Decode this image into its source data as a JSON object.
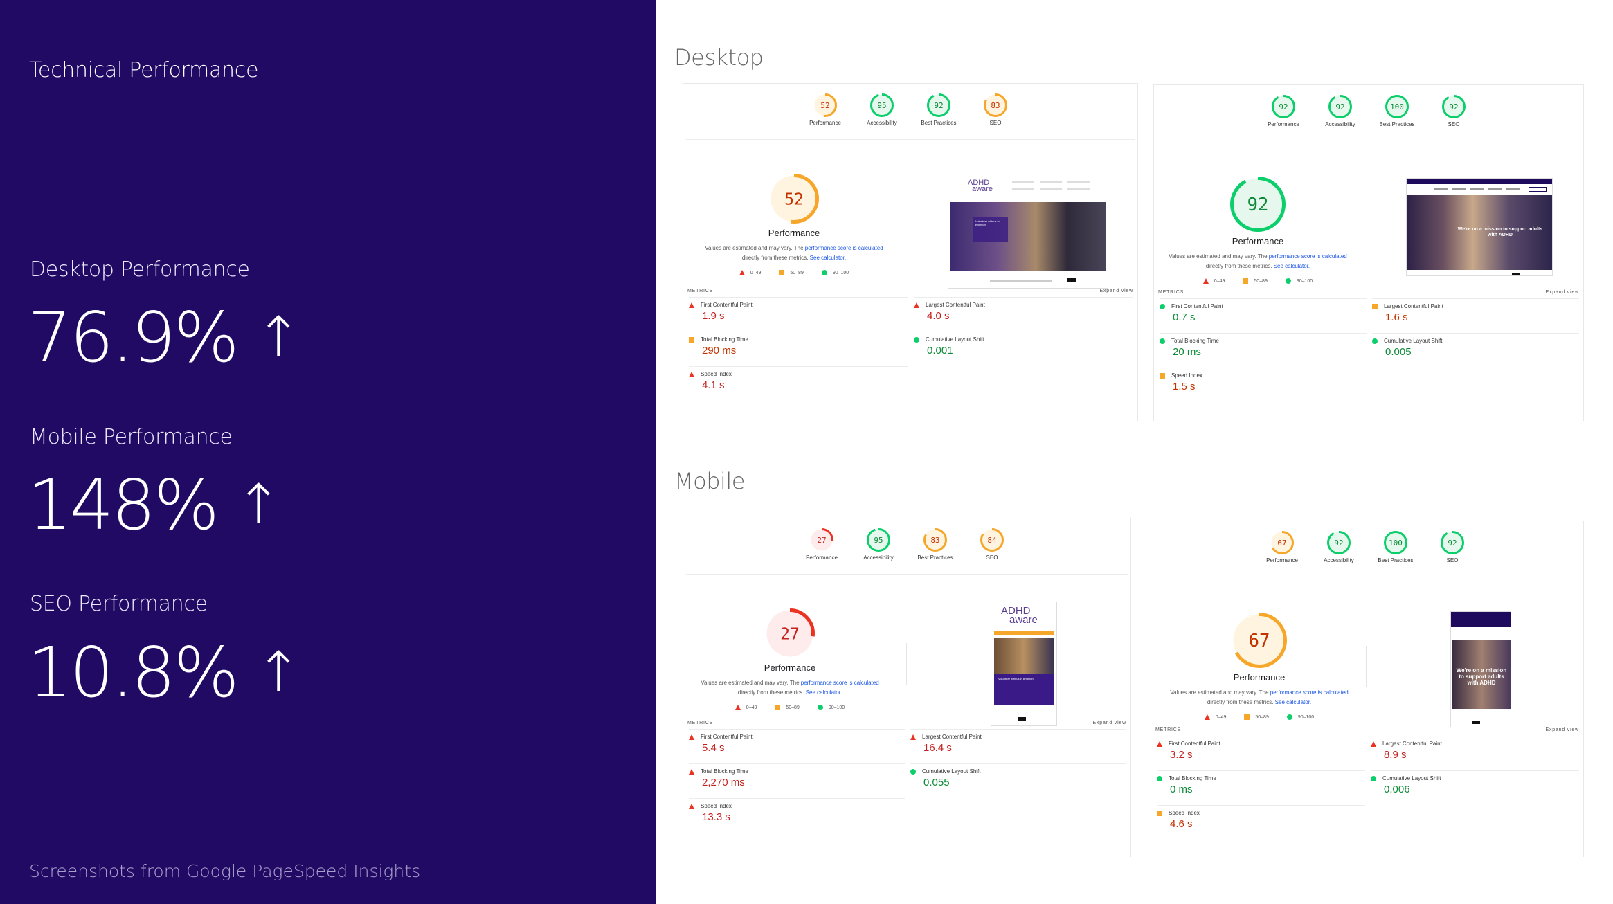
{
  "panel": {
    "title": "Technical Performance",
    "stats": [
      {
        "label": "Desktop Performance",
        "value": "76.9%",
        "arrow": "↑"
      },
      {
        "label": "Mobile Performance",
        "value": "148%",
        "arrow": "↑"
      },
      {
        "label": "SEO Performance",
        "value": "10.8%",
        "arrow": "↑"
      }
    ],
    "footnote": "Screenshots from Google PageSpeed Insights"
  },
  "sections": {
    "desktop": "Desktop",
    "mobile": "Mobile"
  },
  "common": {
    "performance": "Performance",
    "note_a": "Values are estimated and may vary. The ",
    "note_link": "performance score is calculated",
    "note_b": " directly from these metrics. ",
    "note_calc": "See calculator.",
    "legend": [
      "0–49",
      "50–89",
      "90–100"
    ],
    "metrics_label": "METRICS",
    "expand": "Expand view"
  },
  "reports": [
    {
      "gauges": [
        {
          "label": "Performance",
          "score": 52
        },
        {
          "label": "Accessibility",
          "score": 95
        },
        {
          "label": "Best Practices",
          "score": 92
        },
        {
          "label": "SEO",
          "score": 83
        }
      ],
      "big_score": 52,
      "metrics": [
        {
          "name": "First Contentful Paint",
          "value": "1.9 s",
          "status": "poor"
        },
        {
          "name": "Largest Contentful Paint",
          "value": "4.0 s",
          "status": "poor"
        },
        {
          "name": "Total Blocking Time",
          "value": "290 ms",
          "status": "average"
        },
        {
          "name": "Cumulative Layout Shift",
          "value": "0.001",
          "status": "good"
        },
        {
          "name": "Speed Index",
          "value": "4.1 s",
          "status": "poor"
        }
      ]
    },
    {
      "gauges": [
        {
          "label": "Performance",
          "score": 92
        },
        {
          "label": "Accessibility",
          "score": 92
        },
        {
          "label": "Best Practices",
          "score": 100
        },
        {
          "label": "SEO",
          "score": 92
        }
      ],
      "big_score": 92,
      "metrics": [
        {
          "name": "First Contentful Paint",
          "value": "0.7 s",
          "status": "good"
        },
        {
          "name": "Largest Contentful Paint",
          "value": "1.6 s",
          "status": "average"
        },
        {
          "name": "Total Blocking Time",
          "value": "20 ms",
          "status": "good"
        },
        {
          "name": "Cumulative Layout Shift",
          "value": "0.005",
          "status": "good"
        },
        {
          "name": "Speed Index",
          "value": "1.5 s",
          "status": "average"
        }
      ]
    },
    {
      "gauges": [
        {
          "label": "Performance",
          "score": 27
        },
        {
          "label": "Accessibility",
          "score": 95
        },
        {
          "label": "Best Practices",
          "score": 83
        },
        {
          "label": "SEO",
          "score": 84
        }
      ],
      "big_score": 27,
      "metrics": [
        {
          "name": "First Contentful Paint",
          "value": "5.4 s",
          "status": "poor"
        },
        {
          "name": "Largest Contentful Paint",
          "value": "16.4 s",
          "status": "poor"
        },
        {
          "name": "Total Blocking Time",
          "value": "2,270 ms",
          "status": "poor"
        },
        {
          "name": "Cumulative Layout Shift",
          "value": "0.055",
          "status": "good"
        },
        {
          "name": "Speed Index",
          "value": "13.3 s",
          "status": "poor"
        }
      ]
    },
    {
      "gauges": [
        {
          "label": "Performance",
          "score": 67
        },
        {
          "label": "Accessibility",
          "score": 92
        },
        {
          "label": "Best Practices",
          "score": 100
        },
        {
          "label": "SEO",
          "score": 92
        }
      ],
      "big_score": 67,
      "metrics": [
        {
          "name": "First Contentful Paint",
          "value": "3.2 s",
          "status": "poor"
        },
        {
          "name": "Largest Contentful Paint",
          "value": "8.9 s",
          "status": "poor"
        },
        {
          "name": "Total Blocking Time",
          "value": "0 ms",
          "status": "good"
        },
        {
          "name": "Cumulative Layout Shift",
          "value": "0.006",
          "status": "good"
        },
        {
          "name": "Speed Index",
          "value": "4.6 s",
          "status": "average"
        }
      ]
    }
  ],
  "site": {
    "logo_line1": "ADHD",
    "logo_line2": "aware",
    "hero_old": "Volunteer with us in Brighton",
    "hero_new": "We're on a mission to support adults with ADHD",
    "hero_new_mobile": "We're on a mission to support adults with ADHD"
  },
  "colors": {
    "panel_bg": "#200a63",
    "poor": "#eb3323",
    "average": "#f6a629",
    "good": "#0cce6b"
  }
}
